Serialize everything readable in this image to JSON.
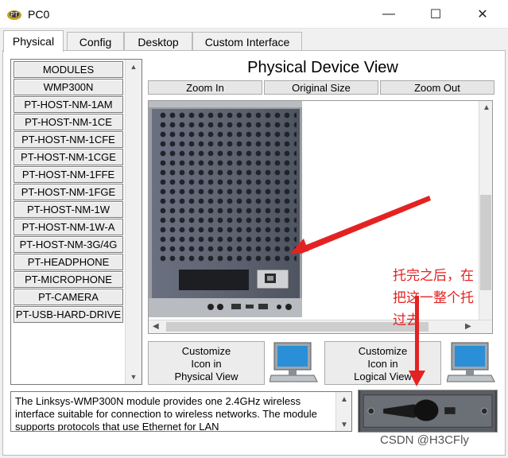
{
  "window": {
    "title": "PC0",
    "minimize_glyph": "—",
    "maximize_glyph": "☐",
    "close_glyph": "✕"
  },
  "tabs": [
    {
      "label": "Physical",
      "active": true
    },
    {
      "label": "Config",
      "active": false
    },
    {
      "label": "Desktop",
      "active": false
    },
    {
      "label": "Custom Interface",
      "active": false
    }
  ],
  "modules": [
    "MODULES",
    "WMP300N",
    "PT-HOST-NM-1AM",
    "PT-HOST-NM-1CE",
    "PT-HOST-NM-1CFE",
    "PT-HOST-NM-1CGE",
    "PT-HOST-NM-1FFE",
    "PT-HOST-NM-1FGE",
    "PT-HOST-NM-1W",
    "PT-HOST-NM-1W-A",
    "PT-HOST-NM-3G/4G",
    "PT-HEADPHONE",
    "PT-MICROPHONE",
    "PT-CAMERA",
    "PT-USB-HARD-DRIVE"
  ],
  "physical_view": {
    "title": "Physical Device View",
    "zoom_in": "Zoom In",
    "original_size": "Original Size",
    "zoom_out": "Zoom Out"
  },
  "customize": {
    "physical": {
      "line1": "Customize",
      "line2": "Icon in",
      "line3": "Physical View"
    },
    "logical": {
      "line1": "Customize",
      "line2": "Icon in",
      "line3": "Logical View"
    }
  },
  "description": "The Linksys-WMP300N module provides one 2.4GHz wireless interface suitable for connection to wireless networks. The module supports protocols that use Ethernet for LAN",
  "annotation": {
    "line1": "托完之后，在",
    "line2": "把这一整个托",
    "line3": "过去"
  },
  "watermark": "CSDN @H3CFly",
  "colors": {
    "annotation": "#e42222",
    "device_panel": "#5d6370",
    "monitor_blue": "#2a8fd6"
  }
}
